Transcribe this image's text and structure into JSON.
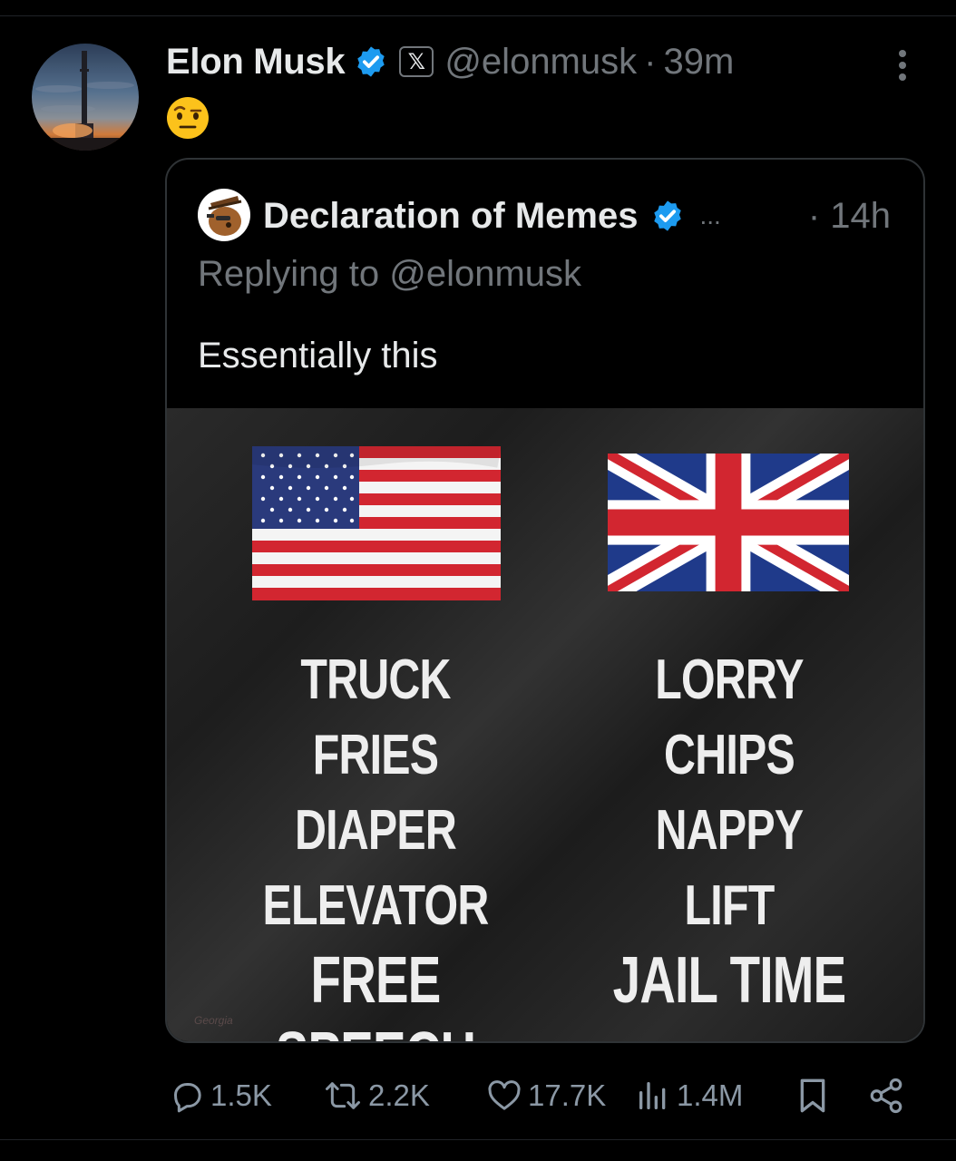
{
  "tweet": {
    "author_name": "Elon Musk",
    "x_badge": "𝕏",
    "handle": "@elonmusk",
    "separator": "·",
    "time": "39m",
    "body_emoji": "face-with-raised-eyebrow"
  },
  "quote": {
    "author_name": "Declaration of Memes",
    "ellipsis": "...",
    "time": "· 14h",
    "replying_to": "Replying to @elonmusk",
    "text": "Essentially this",
    "meme": {
      "us_words": [
        "TRUCK",
        "FRIES",
        "DIAPER",
        "ELEVATOR",
        "FREE SPEECH"
      ],
      "uk_words": [
        "LORRY",
        "CHIPS",
        "NAPPY",
        "LIFT",
        "JAIL TIME"
      ],
      "watermark": "Georgia"
    }
  },
  "actions": {
    "replies": "1.5K",
    "reposts": "2.2K",
    "likes": "17.7K",
    "views": "1.4M"
  },
  "colors": {
    "background": "#000000",
    "verified_blue": "#1d9bf0",
    "muted_text": "#71767b",
    "primary_text": "#e7e9ea",
    "border": "#2f3336"
  }
}
